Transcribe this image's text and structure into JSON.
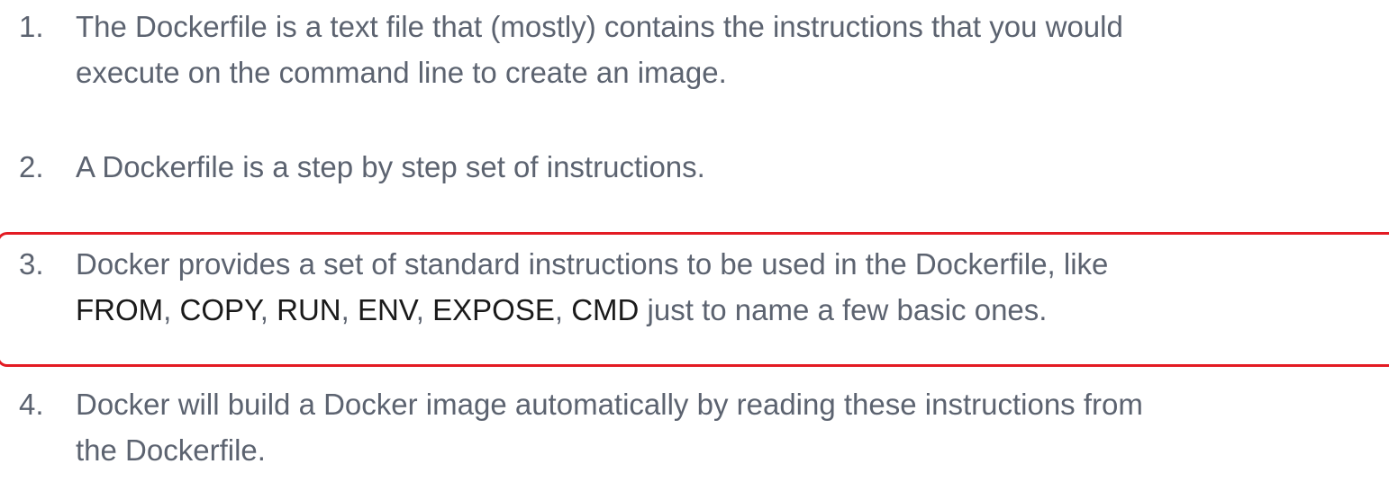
{
  "items": [
    {
      "number": "1.",
      "line1": "The Dockerfile is a text file that (mostly) contains the instructions that you would",
      "line2": "execute on the command line to create an image."
    },
    {
      "number": "2.",
      "line1": "A Dockerfile is a step by step set of instructions."
    },
    {
      "number": "3.",
      "line1": "Docker provides a set of standard instructions to be used in the Dockerfile, like",
      "keywords": [
        "FROM",
        "COPY",
        "RUN",
        "ENV",
        "EXPOSE",
        "CMD"
      ],
      "separator": ", ",
      "line2_suffix": " just to name a few basic ones."
    },
    {
      "number": "4.",
      "line1": "Docker will build a Docker image automatically by reading these instructions from",
      "line2": "the Dockerfile."
    }
  ],
  "highlight": {
    "color": "#e31b23",
    "target_item": "3."
  }
}
